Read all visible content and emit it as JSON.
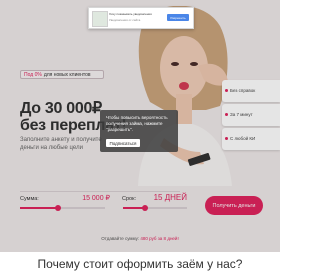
{
  "notification": {
    "line1": "Хочу показывать уведомления",
    "line2": "Уведомления от сайта",
    "allow_label": "Разрешить"
  },
  "promo": {
    "percent": "Под 0%",
    "text": "для новых клиентов"
  },
  "hero": {
    "headline_line1": "До 30 000₽",
    "headline_line2": "без переплат!",
    "sub_line1": "Заполните анкету и получите",
    "sub_line2": "деньги на любые цели"
  },
  "features": [
    {
      "label": "Без справок"
    },
    {
      "label": "За 7 минут"
    },
    {
      "label": "С любой КИ"
    }
  ],
  "popup": {
    "line1": "Чтобы повысить вероятность",
    "line2": "получения займа, нажмите",
    "line3": "\"разрешить\".",
    "button_label": "Подписаться"
  },
  "calculator": {
    "sum_label": "Сумма:",
    "sum_value": "15 000 ₽",
    "term_label": "Срок:",
    "term_value": "15 ДНЕЙ",
    "sum_fill_fraction": 0.45,
    "term_fill_fraction": 0.35,
    "cta_label": "Получить деньги",
    "return_text": "Отдавайте сумму: ",
    "return_amount": "480 руб за 8 дней!",
    "accent_color": "#e0245e"
  },
  "next_section": {
    "title": "Почему стоит оформить заём у нас?"
  }
}
